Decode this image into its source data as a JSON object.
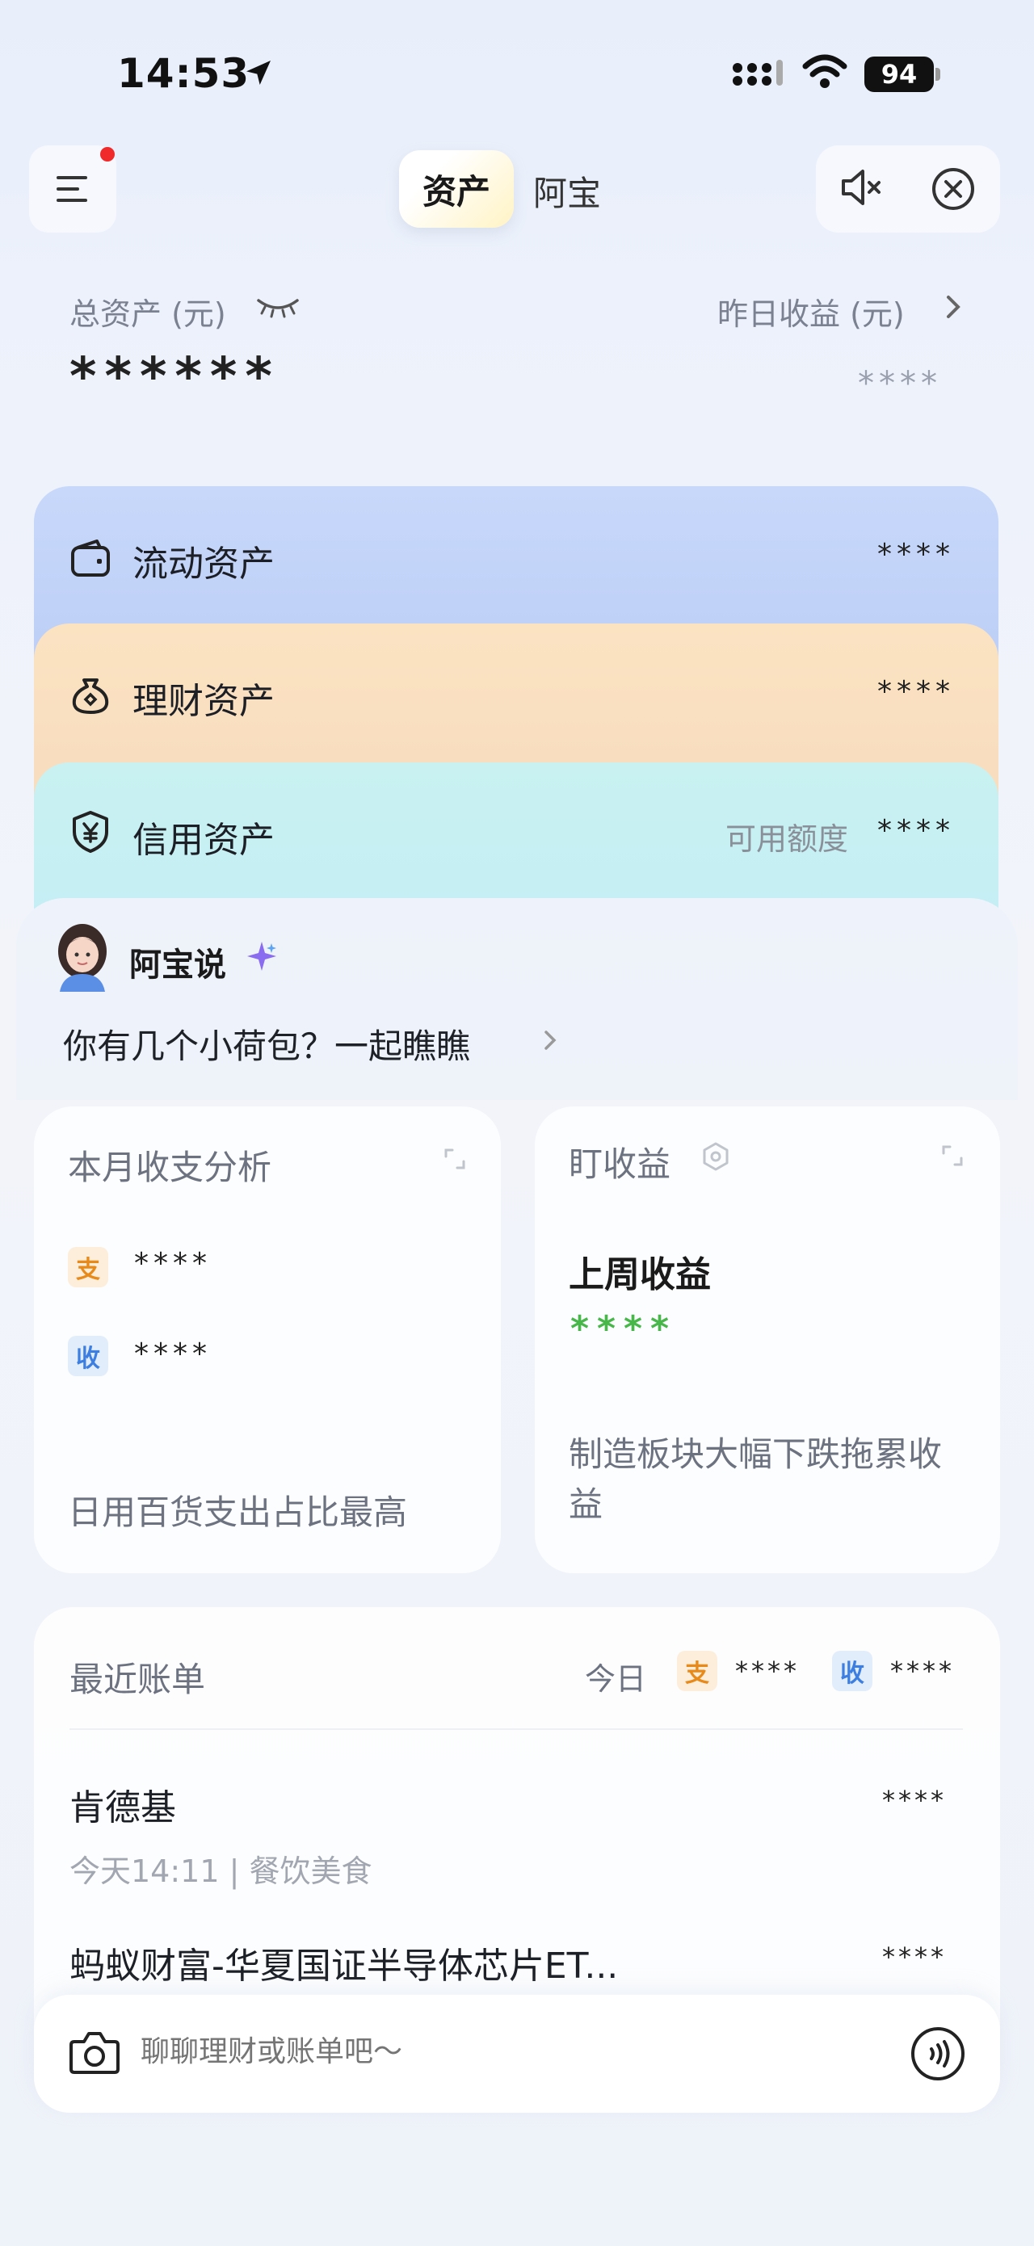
{
  "status_bar": {
    "time": "14:53",
    "battery": "94"
  },
  "header": {
    "tabs": [
      {
        "label": "资产"
      },
      {
        "label": "阿宝"
      }
    ]
  },
  "summary": {
    "total_label": "总资产 (元)",
    "total_value": "******",
    "yesterday_label": "昨日收益 (元)",
    "yesterday_value": "****"
  },
  "asset_cards": {
    "liquid": {
      "label": "流动资产",
      "value": "****"
    },
    "finance": {
      "label": "理财资产",
      "value": "****"
    },
    "credit": {
      "label": "信用资产",
      "sub_label": "可用额度",
      "value": "****"
    }
  },
  "abao": {
    "title": "阿宝说",
    "message": "你有几个小荷包？一起瞧瞧"
  },
  "monthly_analysis": {
    "title": "本月收支分析",
    "pay_tag": "支",
    "pay_value": "****",
    "income_tag": "收",
    "income_value": "****",
    "footer": "日用百货支出占比最高"
  },
  "watch_earnings": {
    "title": "盯收益",
    "subtitle": "上周收益",
    "value": "****",
    "footer": "制造板块大幅下跌拖累收益"
  },
  "recent_bills": {
    "title": "最近账单",
    "today_label": "今日",
    "pay_tag": "支",
    "pay_value": "****",
    "income_tag": "收",
    "income_value": "****",
    "items": [
      {
        "name": "肯德基",
        "meta": "今天14:11 | 餐饮美食",
        "value": "****"
      },
      {
        "name": "蚂蚁财富-华夏国证半导体芯片ET...",
        "value": "****"
      }
    ]
  },
  "chat_input": {
    "placeholder": "聊聊理财或账单吧～"
  },
  "colors": {
    "liquid_card": "#c8d8fb",
    "finance_card": "#fbe3c2",
    "credit_card": "#c9f1f2",
    "pay_tag": "#e88a1a",
    "income_tag": "#3d7fe0",
    "earnings_green": "#47b74a",
    "notification_dot": "#f02a2a"
  }
}
